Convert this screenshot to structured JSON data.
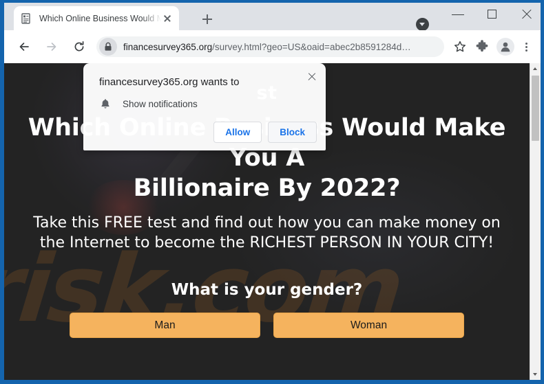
{
  "window": {
    "controls": {
      "tab_search": "tab-search",
      "minimize": "minimize",
      "maximize": "maximize",
      "close": "close"
    }
  },
  "browser": {
    "tab": {
      "title": "Which Online Business Would M…",
      "favicon": "document-icon",
      "close_label": "close-tab"
    },
    "new_tab_label": "new-tab",
    "toolbar": {
      "back": "back",
      "forward": "forward",
      "reload": "reload",
      "url_host": "financesurvey365.org",
      "url_path": "/survey.html?geo=US&oaid=abec2b8591284d…",
      "lock": "lock-icon",
      "bookmark": "star-icon",
      "extensions": "puzzle-icon",
      "profile": "avatar-icon",
      "menu": "kebab-menu-icon"
    }
  },
  "permission_dialog": {
    "title": "financesurvey365.org wants to",
    "permission_icon": "bell-icon",
    "permission_label": "Show notifications",
    "allow_label": "Allow",
    "block_label": "Block",
    "close_label": "close-dialog"
  },
  "page": {
    "pretitle_fragment": "st",
    "headline_line1": "Which Online Business Would Make You A",
    "headline_line2": "Billionaire By 2022?",
    "subhead_line1": "Take this FREE test and find out how you can make money on",
    "subhead_line2": "the Internet to become the RICHEST PERSON IN YOUR CITY!",
    "question": "What is your gender?",
    "answers": [
      {
        "label": "Man"
      },
      {
        "label": "Woman"
      }
    ],
    "watermark": "risk.com",
    "watermark_bg": "7"
  },
  "colors": {
    "frame_blue": "#1464ad",
    "chrome_bg": "#dee1e6",
    "page_bg": "#232323",
    "answer_orange": "#f5b35e",
    "link_blue": "#1a73e8"
  },
  "scrollbar": {
    "up": "scroll-up",
    "down": "scroll-down",
    "thumb": "scroll-thumb"
  }
}
